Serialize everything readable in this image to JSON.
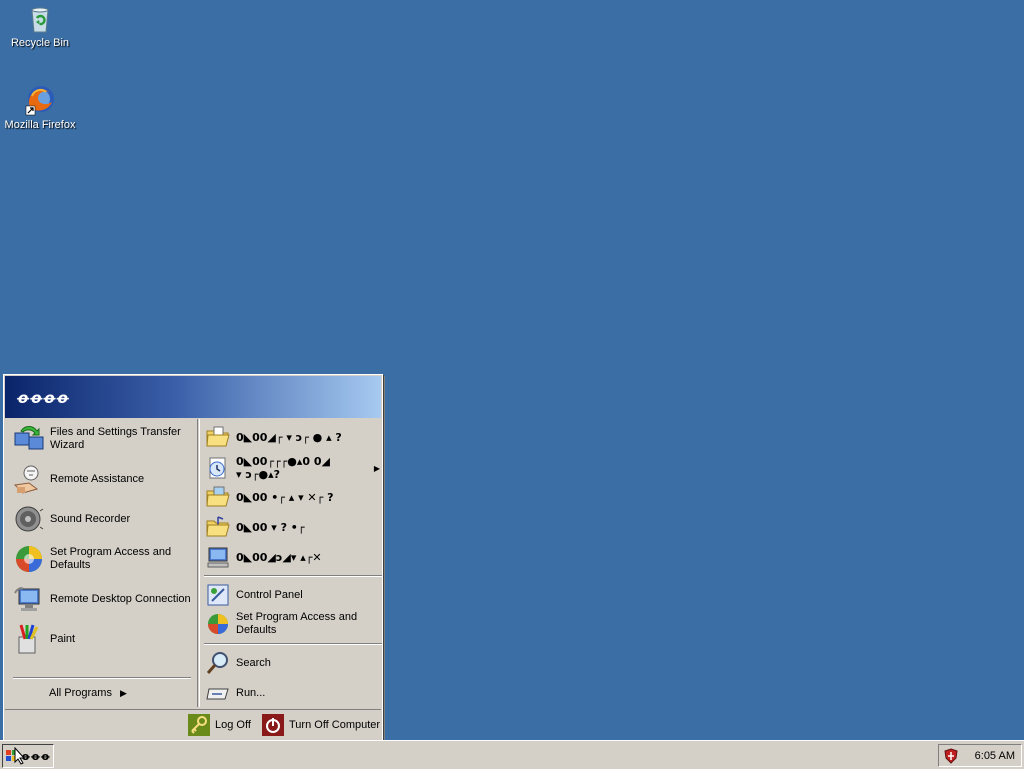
{
  "desktop": {
    "icons": [
      {
        "label": "Recycle Bin",
        "icon": "recycle-bin-icon"
      },
      {
        "label": "Mozilla Firefox",
        "icon": "firefox-icon"
      }
    ],
    "background_color": "#3a6ea5"
  },
  "start_menu": {
    "username": "ꝋꝋꝋꝋ",
    "pinned_left": [
      {
        "label": "Files and Settings Transfer Wizard",
        "icon": "transfer-wizard-icon"
      },
      {
        "label": "Remote Assistance",
        "icon": "remote-assistance-icon"
      },
      {
        "label": "Sound Recorder",
        "icon": "sound-recorder-icon"
      },
      {
        "label": "Set Program Access and Defaults",
        "icon": "program-access-icon"
      },
      {
        "label": "Remote Desktop Connection",
        "icon": "remote-desktop-icon"
      },
      {
        "label": "Paint",
        "icon": "paint-icon"
      }
    ],
    "all_programs": "All Programs",
    "right_places": [
      {
        "label": "0◣00◢┌ ▾ ↄ┌ ● ▴ ?",
        "icon": "folder-documents-icon"
      },
      {
        "label": "0◣00┌┌┌●▴0 0◢ ▾ ↄ┌●▴?",
        "icon": "recent-documents-icon"
      },
      {
        "label": "0◣00 •┌ ▴ ▾ ✕┌ ?",
        "icon": "folder-pictures-icon"
      },
      {
        "label": "0◣00 ▾ ? •┌",
        "icon": "folder-music-icon"
      },
      {
        "label": "0◣00◢ↄ◢▾ ▴┌✕",
        "icon": "my-computer-icon"
      }
    ],
    "right_settings": [
      {
        "label": "Control Panel",
        "icon": "control-panel-icon"
      },
      {
        "label": "Set Program Access and Defaults",
        "icon": "program-access-icon"
      }
    ],
    "right_tools": [
      {
        "label": "Search",
        "icon": "search-icon"
      },
      {
        "label": "Run...",
        "icon": "run-icon"
      }
    ],
    "footer": {
      "log_off": "Log Off",
      "turn_off": "Turn Off Computer"
    }
  },
  "taskbar": {
    "start_label": "ꝋꝋꝋ",
    "clock": "6:05 AM"
  }
}
